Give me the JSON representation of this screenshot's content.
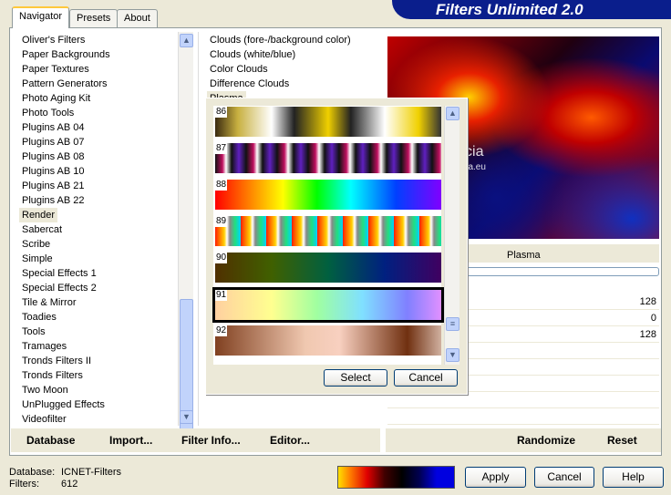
{
  "header": {
    "title": "Filters Unlimited 2.0"
  },
  "tabs": [
    {
      "label": "Navigator",
      "active": true
    },
    {
      "label": "Presets"
    },
    {
      "label": "About"
    }
  ],
  "categories": [
    "Oliver's Filters",
    "Paper Backgrounds",
    "Paper Textures",
    "Pattern Generators",
    "Photo Aging Kit",
    "Photo Tools",
    "Plugins AB 04",
    "Plugins AB 07",
    "Plugins AB 08",
    "Plugins AB 10",
    "Plugins AB 21",
    "Plugins AB 22",
    "Render",
    "Sabercat",
    "Scribe",
    "Simple",
    "Special Effects 1",
    "Special Effects 2",
    "Tile & Mirror",
    "Toadies",
    "Tools",
    "Tramages",
    "Tronds Filters II",
    "Tronds Filters",
    "Two Moon",
    "UnPlugged Effects",
    "Videofilter"
  ],
  "selected_category": "Render",
  "filters": [
    "Clouds (fore-/background color)",
    "Clouds (white/blue)",
    "Color Clouds",
    "Difference Clouds",
    "Plasma"
  ],
  "preview": {
    "watermark_title": "Pinuccia",
    "watermark_url": "www.maildigrafica.eu"
  },
  "filter_name": "Plasma",
  "params": [
    "128",
    "0",
    "128"
  ],
  "gradient_dialog": {
    "swatches": [
      "86",
      "87",
      "88",
      "89",
      "90",
      "91",
      "92"
    ],
    "selected": "91",
    "select_label": "Select",
    "cancel_label": "Cancel"
  },
  "bottom_left": {
    "database": "Database",
    "import": "Import...",
    "filter_info": "Filter Info...",
    "editor": "Editor..."
  },
  "bottom_right": {
    "randomize": "Randomize",
    "reset": "Reset"
  },
  "status": {
    "database_label": "Database:",
    "database_value": "ICNET-Filters",
    "filters_label": "Filters:",
    "filters_value": "612"
  },
  "buttons": {
    "apply": "Apply",
    "cancel": "Cancel",
    "help": "Help"
  }
}
